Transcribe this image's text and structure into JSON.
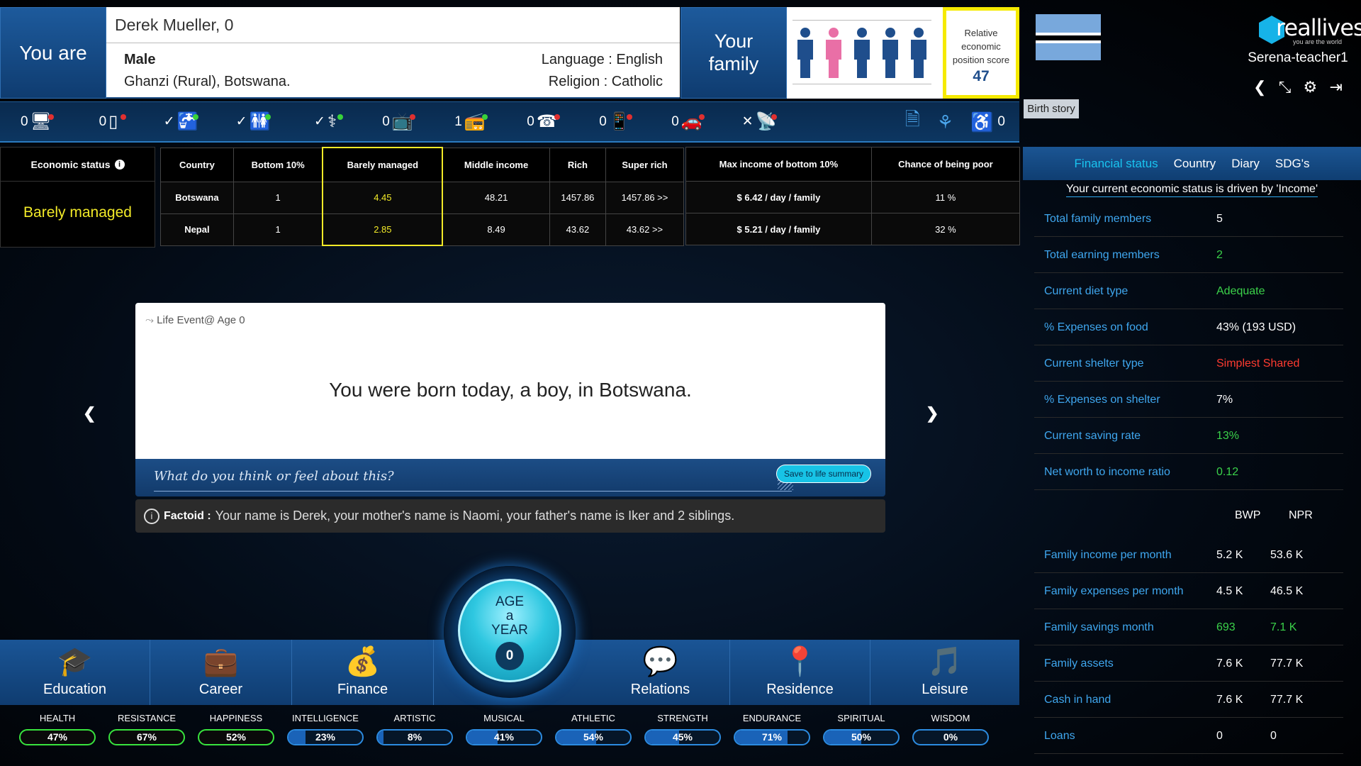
{
  "header": {
    "you_are": "You are",
    "name_age": "Derek Mueller, 0",
    "gender": "Male",
    "location": "Ghanzi (Rural), Botswana.",
    "language": "Language : English",
    "religion": "Religion : Catholic",
    "your_family": "Your family",
    "family_members": [
      "male-adult",
      "female-adult",
      "male-child",
      "male-child",
      "male-child"
    ],
    "score_label": "Relative economic position score",
    "score_value": "47",
    "flag": "Botswana",
    "birth_story": "Birth story",
    "logo_text": "reallives",
    "logo_tagline": "you are the world",
    "username": "Serena-teacher1",
    "icons": [
      "back-icon",
      "collapse-icon",
      "settings-icon",
      "logout-icon"
    ]
  },
  "amenities": [
    {
      "icon": "computer-icon",
      "glyph": "🖥",
      "value": "0",
      "dot": "#e03030"
    },
    {
      "icon": "fridge-icon",
      "glyph": "▯",
      "value": "0",
      "dot": "#e03030"
    },
    {
      "icon": "water-tap-icon",
      "glyph": "🚰",
      "value": "✓",
      "dot": "#38d23a"
    },
    {
      "icon": "toilet-icon",
      "glyph": "🚻",
      "value": "✓",
      "dot": "#38d23a"
    },
    {
      "icon": "healthcare-icon",
      "glyph": "⚕",
      "value": "✓",
      "dot": "#38d23a"
    },
    {
      "icon": "tv-icon",
      "glyph": "📺",
      "value": "0",
      "dot": "#e03030"
    },
    {
      "icon": "radio-icon",
      "glyph": "📻",
      "value": "1",
      "dot": "#38d23a"
    },
    {
      "icon": "telephone-icon",
      "glyph": "☎",
      "value": "0",
      "dot": "#e03030"
    },
    {
      "icon": "mobile-icon",
      "glyph": "📱",
      "value": "0",
      "dot": "#e03030"
    },
    {
      "icon": "car-icon",
      "glyph": "🚗",
      "value": "0",
      "dot": "#e03030"
    },
    {
      "icon": "internet-icon",
      "glyph": "📡",
      "value": "✕",
      "dot": "#e03030"
    }
  ],
  "amenities_right": {
    "icons": [
      "documents-icon",
      "organization-icon",
      "disability-icon"
    ],
    "count": "0"
  },
  "economic_status": {
    "label": "Economic status",
    "value": "Barely managed"
  },
  "econ_table": {
    "headers": [
      "Country",
      "Bottom 10%",
      "Barely managed",
      "Middle income",
      "Rich",
      "Super rich"
    ],
    "rows": [
      [
        "Botswana",
        "1",
        "4.45",
        "48.21",
        "1457.86",
        "1457.86 >>"
      ],
      [
        "Nepal",
        "1",
        "2.85",
        "8.49",
        "43.62",
        "43.62 >>"
      ]
    ]
  },
  "poverty_table": {
    "headers": [
      "Max income of bottom 10%",
      "Chance of being poor"
    ],
    "rows": [
      [
        "$ 6.42 / day / family",
        "11 %"
      ],
      [
        "$ 5.21 / day / family",
        "32 %"
      ]
    ]
  },
  "life_event": {
    "header": "Life Event@ Age 0",
    "message": "You were born today, a boy, in Botswana.",
    "prompt_placeholder": "What do you think or feel about this?",
    "save_label": "Save to life summary",
    "factoid_label": "Factoid :",
    "factoid_text": "Your name is Derek, your mother's name is Naomi, your father's name is Iker and 2 siblings."
  },
  "age_button": {
    "label_line1": "AGE",
    "label_line2": "a",
    "label_line3": "YEAR",
    "age": "0"
  },
  "bottom_nav": [
    {
      "label": "Education",
      "glyph": "🎓"
    },
    {
      "label": "Career",
      "glyph": "💼"
    },
    {
      "label": "Finance",
      "glyph": "💰"
    },
    {
      "label": "Relations",
      "glyph": "💬"
    },
    {
      "label": "Residence",
      "glyph": "📍"
    },
    {
      "label": "Leisure",
      "glyph": "🎵"
    }
  ],
  "stats": [
    {
      "label": "HEALTH",
      "value": "47%",
      "level": 0.47,
      "style": "green"
    },
    {
      "label": "RESISTANCE",
      "value": "67%",
      "level": 0.67,
      "style": "green"
    },
    {
      "label": "HAPPINESS",
      "value": "52%",
      "level": 0.52,
      "style": "green"
    },
    {
      "label": "INTELLIGENCE",
      "value": "23%",
      "level": 0.23,
      "style": "blue"
    },
    {
      "label": "ARTISTIC",
      "value": "8%",
      "level": 0.08,
      "style": "blue"
    },
    {
      "label": "MUSICAL",
      "value": "41%",
      "level": 0.41,
      "style": "blue"
    },
    {
      "label": "ATHLETIC",
      "value": "54%",
      "level": 0.54,
      "style": "blue"
    },
    {
      "label": "STRENGTH",
      "value": "45%",
      "level": 0.45,
      "style": "blue"
    },
    {
      "label": "ENDURANCE",
      "value": "71%",
      "level": 0.71,
      "style": "blue"
    },
    {
      "label": "SPIRITUAL",
      "value": "50%",
      "level": 0.5,
      "style": "blue"
    },
    {
      "label": "WISDOM",
      "value": "0%",
      "level": 0.0,
      "style": "blue"
    }
  ],
  "right_panel": {
    "tabs": [
      "Financial status",
      "Country",
      "Diary",
      "SDG's"
    ],
    "driven_by": "Your current economic status is driven by 'Income'",
    "rows": [
      {
        "label": "Total family members",
        "value": "5",
        "color": "white"
      },
      {
        "label": "Total earning members",
        "value": "2",
        "color": "green"
      },
      {
        "label": "Current diet type",
        "value": "Adequate",
        "color": "green"
      },
      {
        "label": "% Expenses on food",
        "value": "43% (193 USD)",
        "color": "white"
      },
      {
        "label": "Current shelter type",
        "value": "Simplest Shared",
        "color": "red"
      },
      {
        "label": "% Expenses on shelter",
        "value": "7%",
        "color": "white"
      },
      {
        "label": "Current saving rate",
        "value": "13%",
        "color": "green"
      },
      {
        "label": "Net worth to income ratio",
        "value": "0.12",
        "color": "green"
      }
    ],
    "currency_headers": [
      "BWP",
      "NPR"
    ],
    "money_rows": [
      {
        "label": "Family income per month",
        "bwp": "5.2 K",
        "npr": "53.6 K",
        "color": "white"
      },
      {
        "label": "Family expenses per month",
        "bwp": "4.5 K",
        "npr": "46.5 K",
        "color": "white"
      },
      {
        "label": "Family savings month",
        "bwp": "693",
        "npr": "7.1 K",
        "color": "green"
      },
      {
        "label": "Family assets",
        "bwp": "7.6 K",
        "npr": "77.7 K",
        "color": "white"
      },
      {
        "label": "Cash in hand",
        "bwp": "7.6 K",
        "npr": "77.7 K",
        "color": "white"
      },
      {
        "label": "Loans",
        "bwp": "0",
        "npr": "0",
        "color": "white"
      }
    ]
  }
}
